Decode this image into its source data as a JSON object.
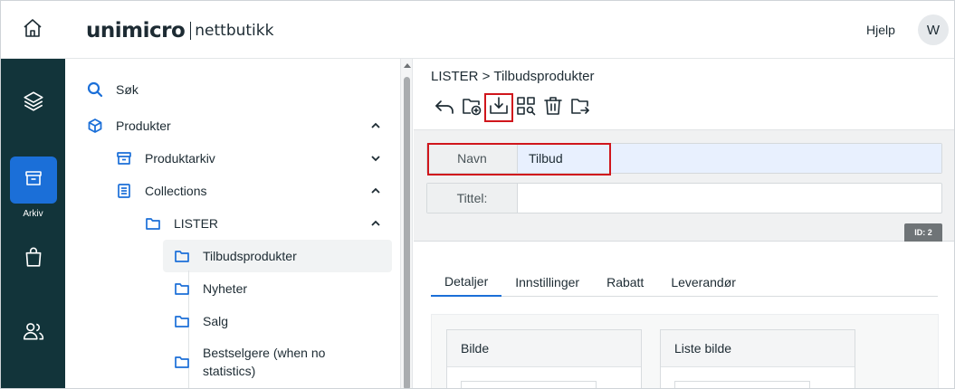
{
  "brand": {
    "name": "unimicro",
    "product": "nettbutikk"
  },
  "header": {
    "help_label": "Hjelp",
    "avatar_initial": "W"
  },
  "rail": {
    "active_label": "Arkiv"
  },
  "tree": {
    "items": [
      {
        "label": "Søk"
      },
      {
        "label": "Produkter"
      },
      {
        "label": "Produktarkiv"
      },
      {
        "label": "Collections"
      },
      {
        "label": "LISTER"
      },
      {
        "label": "Tilbudsprodukter"
      },
      {
        "label": "Nyheter"
      },
      {
        "label": "Salg"
      },
      {
        "label": "Bestselgere (when no",
        "label2": "statistics)"
      }
    ]
  },
  "main": {
    "breadcrumb": "LISTER > Tilbudsprodukter",
    "fields": {
      "navn_label": "Navn",
      "navn_value": "Tilbud",
      "tittel_label": "Tittel:",
      "tittel_value": ""
    },
    "id_badge": "ID: 2",
    "tabs": [
      "Detaljer",
      "Innstillinger",
      "Rabatt",
      "Leverandør"
    ],
    "cards": [
      "Bilde",
      "Liste bilde"
    ]
  }
}
